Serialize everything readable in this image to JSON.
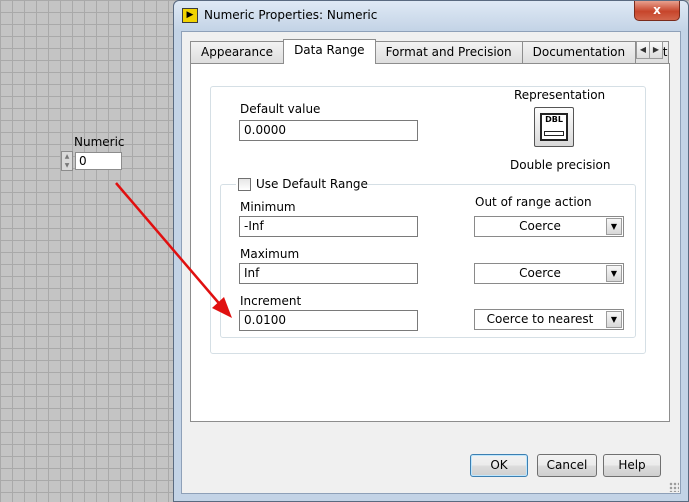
{
  "front_panel": {
    "numeric_label": "Numeric",
    "numeric_value": "0"
  },
  "dialog": {
    "title": "Numeric Properties: Numeric",
    "close_glyph": "x",
    "tabs": [
      {
        "label": "Appearance"
      },
      {
        "label": "Data Range",
        "active": true
      },
      {
        "label": "Format and Precision"
      },
      {
        "label": "Documentation"
      },
      {
        "label": "Data B"
      }
    ],
    "tab_scroll_left": "◀",
    "tab_scroll_right": "▶",
    "default_value_label": "Default value",
    "default_value": "0.0000",
    "representation_label": "Representation",
    "representation_icon_text": "DBL",
    "representation_caption": "Double precision",
    "use_default_range_label": "Use Default Range",
    "use_default_range_checked": false,
    "out_of_range_label": "Out of range action",
    "minimum_label": "Minimum",
    "minimum_value": "-Inf",
    "minimum_action": "Coerce",
    "maximum_label": "Maximum",
    "maximum_value": "Inf",
    "maximum_action": "Coerce",
    "increment_label": "Increment",
    "increment_value": "0.0100",
    "increment_action": "Coerce to nearest",
    "dropdown_glyph": "▼",
    "buttons": {
      "ok": "OK",
      "cancel": "Cancel",
      "help": "Help"
    }
  },
  "annotation_color": "#e01010"
}
